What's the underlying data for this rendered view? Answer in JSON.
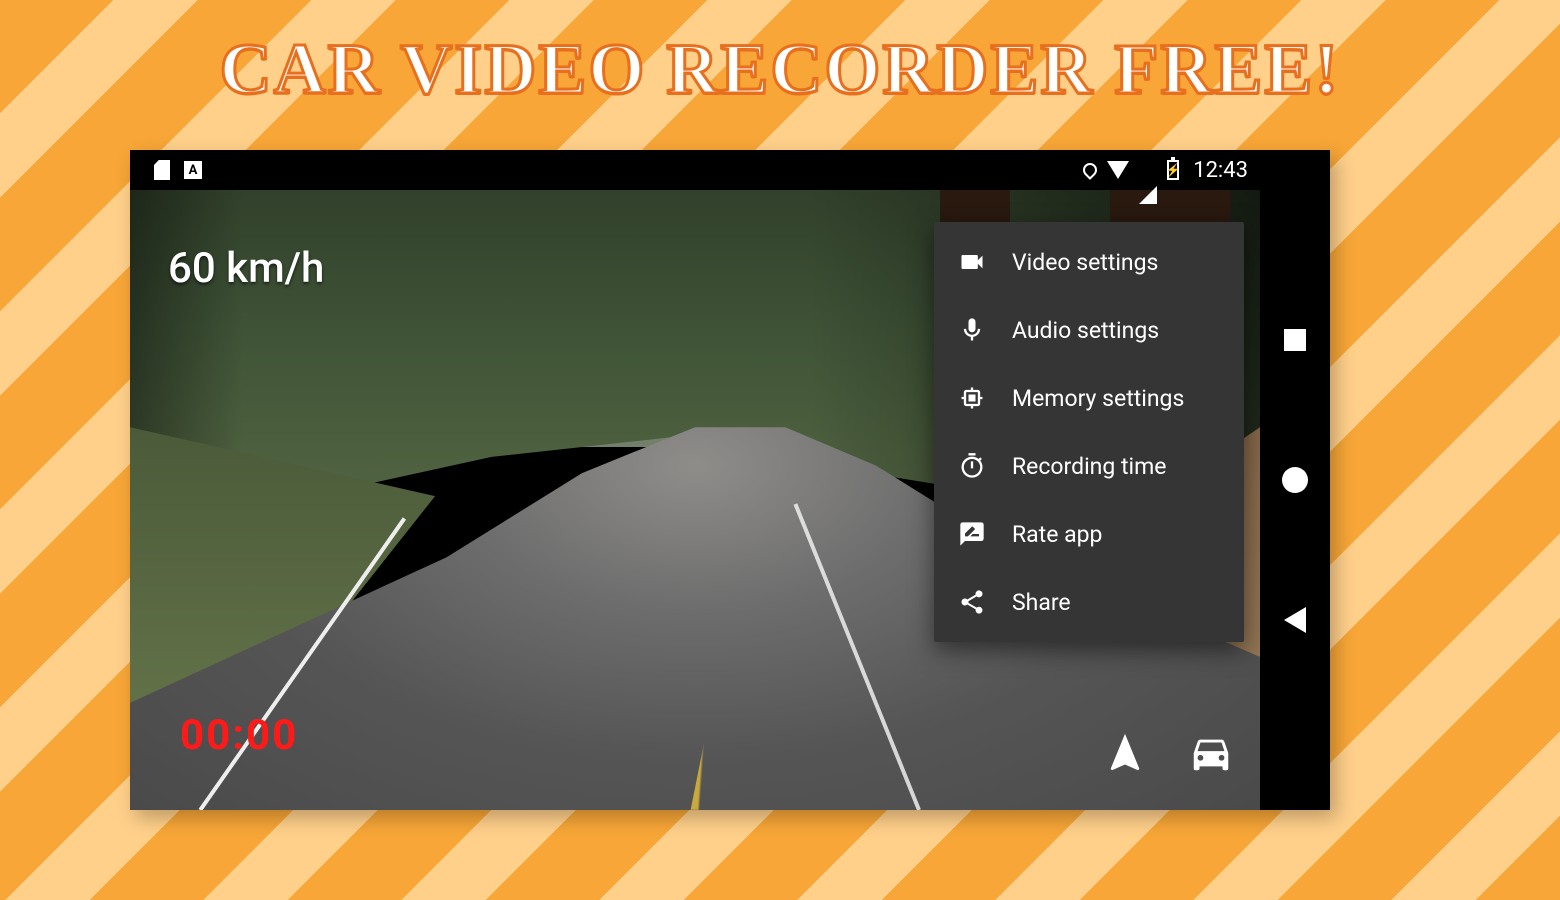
{
  "headline": "CAR VIDEO RECORDER  FREE!",
  "status": {
    "a_icon_letter": "A",
    "time": "12:43"
  },
  "overlay": {
    "speed": "60 km/h",
    "rec_timer": "00:00"
  },
  "menu": {
    "items": [
      {
        "label": "Video settings"
      },
      {
        "label": "Audio settings"
      },
      {
        "label": "Memory settings"
      },
      {
        "label": "Recording time"
      },
      {
        "label": "Rate app"
      },
      {
        "label": "Share"
      }
    ]
  }
}
